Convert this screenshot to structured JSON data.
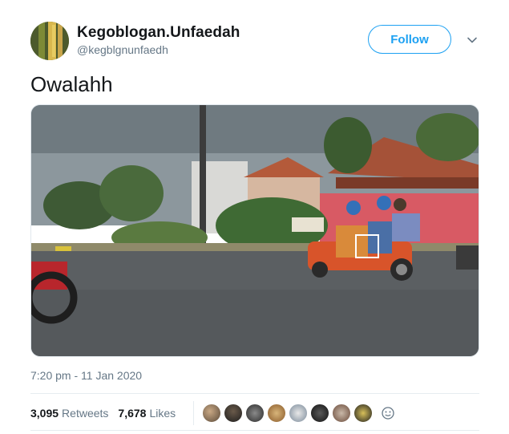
{
  "user": {
    "display_name": "Kegoblogan.Unfaedah",
    "handle": "@kegblgnunfaedh"
  },
  "follow_label": "Follow",
  "tweet": {
    "text": "Owalahh",
    "timestamp": "7:20 pm - 11 Jan 2020"
  },
  "stats": {
    "retweets_count": "3,095",
    "retweets_label": "Retweets",
    "likes_count": "7,678",
    "likes_label": "Likes"
  },
  "colors": {
    "accent": "#1da1f2",
    "secondary_text": "#657786"
  },
  "icons": {
    "caret": "chevron-down-icon",
    "more_likers": "smiley-icon"
  }
}
